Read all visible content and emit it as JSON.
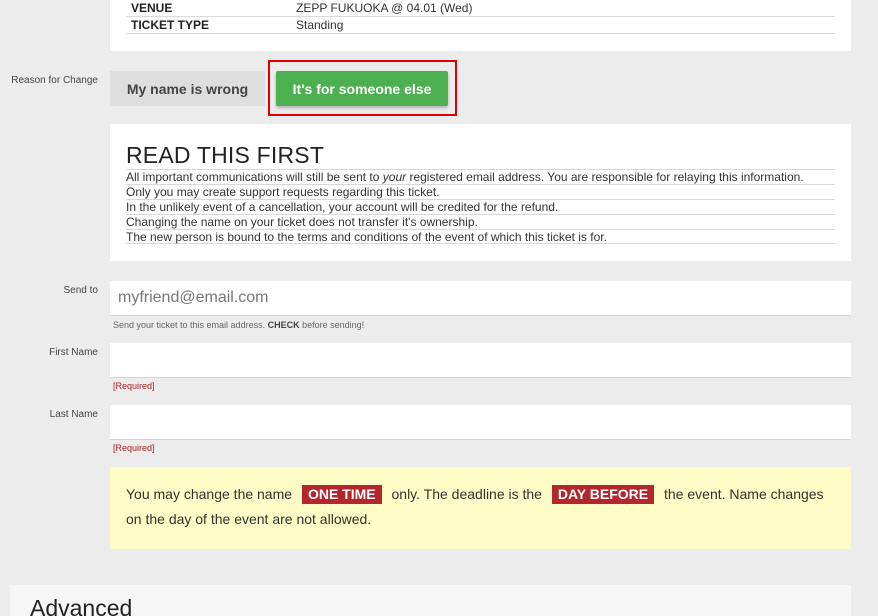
{
  "ticket_info": {
    "rows": [
      {
        "key": "VENUE",
        "value": "ZEPP FUKUOKA @ 04.01 (Wed)"
      },
      {
        "key": "TICKET TYPE",
        "value": "Standing"
      }
    ]
  },
  "reason": {
    "label": "Reason for Change",
    "option_wrong": "My name is wrong",
    "option_else": "It's for someone else"
  },
  "read_first": {
    "title": "READ THIS FIRST",
    "line1_pre": "All important communications will still be sent to ",
    "line1_em": "your",
    "line1_post": " registered email address. You are responsible for relaying this information.",
    "line2": "Only you may create support requests regarding this ticket.",
    "line3": "In the unlikely event of a cancellation, your account will be credited for the refund.",
    "line4": "Changing the name on your ticket does not transfer it's ownership.",
    "line5": "The new person is bound to the terms and conditions of the event of which this ticket is for."
  },
  "send_to": {
    "label": "Send to",
    "placeholder": "myfriend@email.com",
    "hint_pre": "Send your ticket to this email address. ",
    "hint_bold": "CHECK",
    "hint_post": " before sending!"
  },
  "first_name": {
    "label": "First Name",
    "required": "[Required]"
  },
  "last_name": {
    "label": "Last Name",
    "required": "[Required]"
  },
  "notice": {
    "part1": "You may change the name ",
    "badge1": "ONE TIME",
    "part2": " only. The deadline is the ",
    "badge2": "DAY BEFORE",
    "part3": " the event. Name changes on the day of the event are not allowed."
  },
  "advanced": {
    "title": "Advanced"
  },
  "colors": {
    "accent_green": "#4caf50",
    "badge_red": "#b3262d",
    "highlight_red": "#e00000",
    "notice_bg": "#fdfcc6"
  }
}
